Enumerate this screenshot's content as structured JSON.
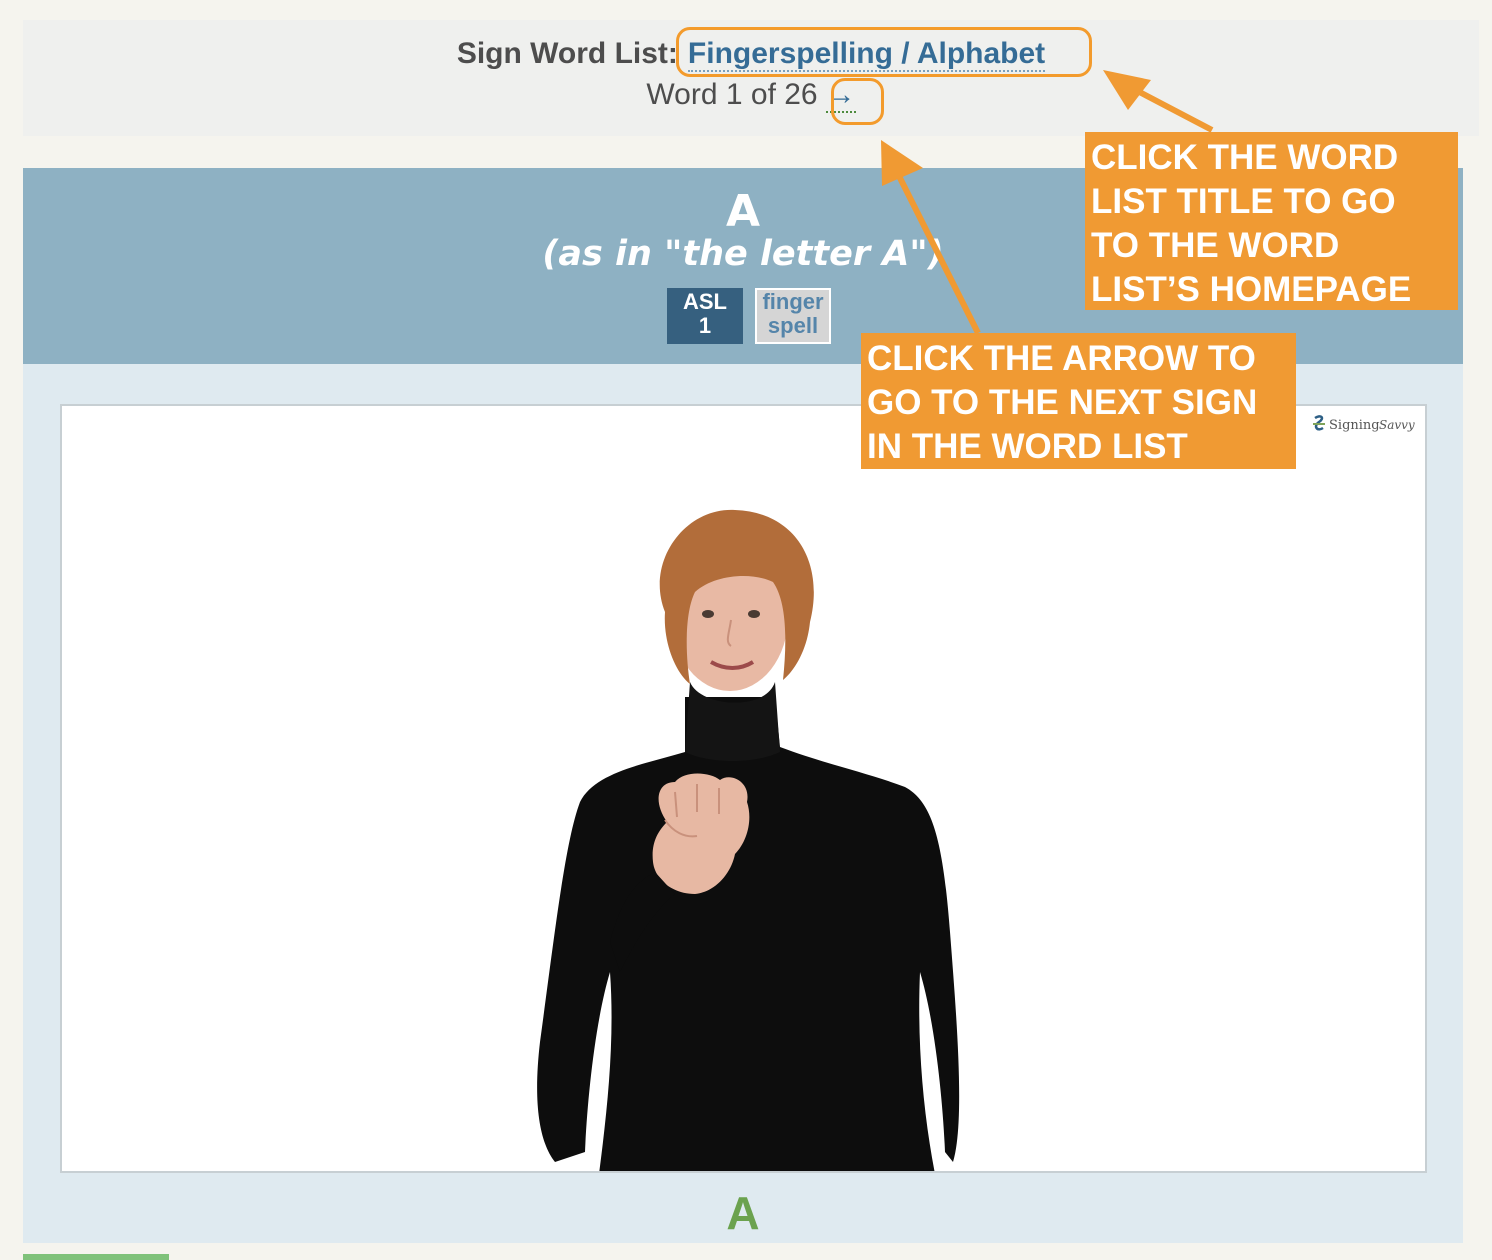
{
  "word_list": {
    "label": "Sign Word List:",
    "title": "Fingerspelling / Alphabet",
    "position_prefix": "Word 1 of 26",
    "next_arrow": "→"
  },
  "sign": {
    "word": "A",
    "sense": "(as in \"the letter A\")",
    "badges": {
      "asl_line1": "ASL",
      "asl_line2": "1",
      "finger_line1": "finger",
      "finger_line2": "spell"
    },
    "watermark_brand": "Signing",
    "watermark_script": "Savvy",
    "caption": "A"
  },
  "callouts": {
    "title_tip": [
      "CLICK THE WORD",
      "LIST TITLE TO GO",
      "TO THE WORD",
      "LIST’S HOMEPAGE"
    ],
    "arrow_tip": [
      "CLICK THE ARROW TO",
      "GO TO THE NEXT SIGN",
      "IN THE WORD LIST"
    ]
  },
  "colors": {
    "link": "#356c96",
    "header_band": "#8eb1c3",
    "asl_badge": "#36607f",
    "caption_green": "#6ba24e",
    "callout_orange": "#f09a33"
  }
}
